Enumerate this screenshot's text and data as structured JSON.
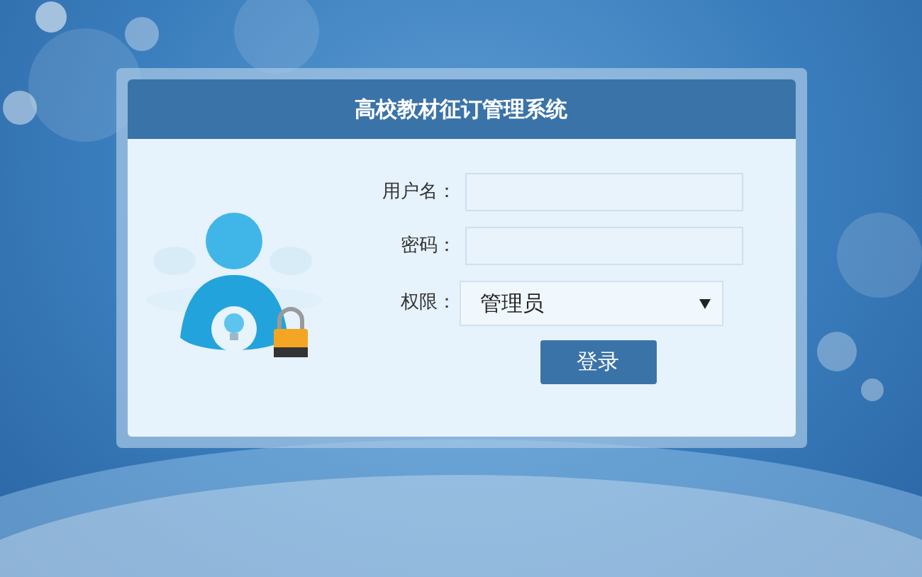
{
  "window": {
    "title": "高校教材征订管理系统"
  },
  "form": {
    "fields": [
      {
        "kind": "text",
        "label": "用户名："
      },
      {
        "kind": "password",
        "label": "密码："
      },
      {
        "kind": "select",
        "label": "权限：",
        "value": "管理员"
      }
    ],
    "submit": "登录"
  }
}
